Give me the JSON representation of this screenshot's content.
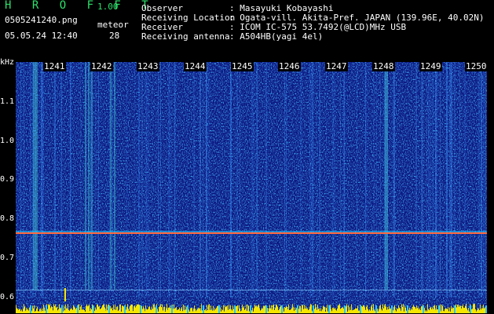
{
  "header": {
    "brand": "H R O F F T",
    "version": "1.00",
    "filename": "0505241240.png",
    "datetime": "05.05.24 12:40",
    "meteor_label": "meteor",
    "meteor_count": "28"
  },
  "info": [
    {
      "key": "Observer",
      "value": ": Masayuki Kobayashi"
    },
    {
      "key": "Receiving Location",
      "value": ": Ogata-vill. Akita-Pref. JAPAN (139.96E, 40.02N)"
    },
    {
      "key": "Receiver",
      "value": ": ICOM IC-575 53.7492(@LCD)MHz USB"
    },
    {
      "key": "Receiving antenna",
      "value": ": A504HB(yagi 4el)"
    }
  ],
  "axis": {
    "unit": "kHz",
    "freq_labels": [
      "1.1",
      "1.0",
      "0.9",
      "0.8",
      "0.7",
      "0.6"
    ],
    "time_labels": [
      "1241",
      "1242",
      "1243",
      "1244",
      "1245",
      "1246",
      "1247",
      "1248",
      "1249",
      "1250"
    ]
  },
  "colors": {
    "background": "#000000",
    "spectrogram_base": "#0a1680",
    "brand_green": "#2ee06a",
    "carrier_line": "#ff6a40",
    "signal_yellow": "#f5e600",
    "tick_cyan": "#28c8ff"
  }
}
